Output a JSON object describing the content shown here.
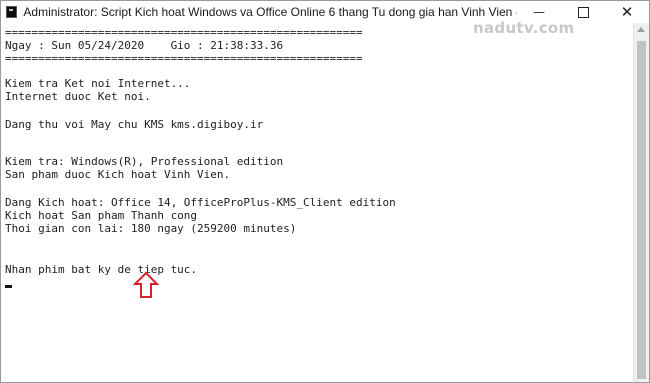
{
  "window": {
    "title": "Administrator:  Script Kich hoat Windows va Office Online 6 thang Tu dong gia han Vinh Vien - Copyright (C) All rights...",
    "min_glyph": "—",
    "close_glyph": "✕"
  },
  "watermark": "nadutv.com",
  "console": {
    "lines": [
      "======================================================",
      "Ngay : Sun 05/24/2020    Gio : 21:38:33.36",
      "======================================================",
      "",
      "Kiem tra Ket noi Internet...",
      "Internet duoc Ket noi.",
      "",
      "Dang thu voi May chu KMS kms.digiboy.ir",
      "",
      "",
      "Kiem tra: Windows(R), Professional edition",
      "San pham duoc Kich hoat Vinh Vien.",
      "",
      "Dang Kich hoat: Office 14, OfficeProPlus-KMS_Client edition",
      "Kich hoat San pham Thanh cong",
      "Thoi gian con lai: 180 ngay (259200 minutes)",
      "",
      "",
      "Nhan phim bat ky de tiep tuc."
    ]
  },
  "annotation": {
    "arrow_color": "#d9232a",
    "arrow_icon": "up-arrow-outline"
  },
  "colors": {
    "console_bg": "#ffffff",
    "console_text": "#1e1e1e"
  }
}
